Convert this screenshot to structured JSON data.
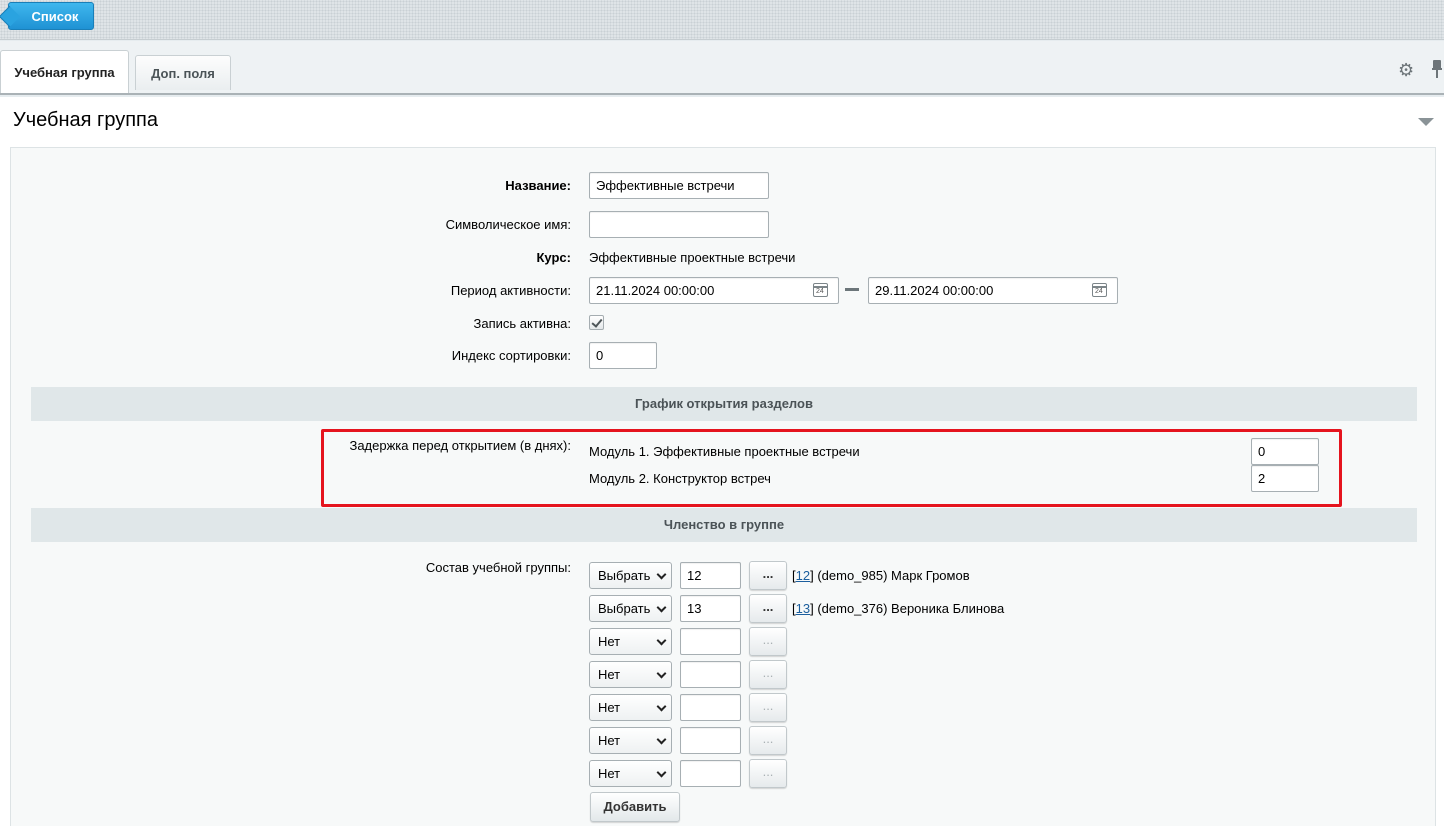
{
  "toolbar": {
    "list_button": "Список"
  },
  "tabs": [
    {
      "label": "Учебная группа",
      "active": true
    },
    {
      "label": "Доп. поля",
      "active": false
    }
  ],
  "panel": {
    "title": "Учебная группа"
  },
  "form": {
    "name_label": "Название:",
    "name_value": "Эффективные встречи",
    "code_label": "Символическое имя:",
    "code_value": "",
    "course_label": "Курс:",
    "course_value": "Эффективные проектные встречи",
    "period_label": "Период активности:",
    "period_from": "21.11.2024 00:00:00",
    "period_to": "29.11.2024 00:00:00",
    "calendar_day": "24",
    "active_label": "Запись активна:",
    "active_checked": true,
    "sort_label": "Индекс сортировки:",
    "sort_value": "0"
  },
  "schedule": {
    "section_title": "График открытия разделов",
    "delay_label": "Задержка перед открытием (в днях):",
    "modules": [
      {
        "name": "Модуль 1. Эффективные проектные встречи",
        "delay": "0"
      },
      {
        "name": "Модуль 2. Конструктор встреч",
        "delay": "2"
      }
    ]
  },
  "membership": {
    "section_title": "Членство в группе",
    "members_label": "Состав учебной группы:",
    "rows": [
      {
        "select": "Выбрать",
        "id": "12",
        "link": "12",
        "desc": "(demo_985) Марк Громов",
        "enabled": true
      },
      {
        "select": "Выбрать",
        "id": "13",
        "link": "13",
        "desc": "(demo_376) Вероника Блинова",
        "enabled": true
      },
      {
        "select": "Нет",
        "id": "",
        "enabled": false
      },
      {
        "select": "Нет",
        "id": "",
        "enabled": false
      },
      {
        "select": "Нет",
        "id": "",
        "enabled": false
      },
      {
        "select": "Нет",
        "id": "",
        "enabled": false
      },
      {
        "select": "Нет",
        "id": "",
        "enabled": false
      }
    ],
    "dots_label": "...",
    "add_button": "Добавить"
  }
}
